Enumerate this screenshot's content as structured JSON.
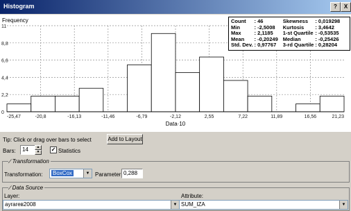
{
  "window": {
    "title": "Histogram",
    "help_label": "?",
    "close_label": "X"
  },
  "chart_data": {
    "type": "bar",
    "ylabel": "Frequency",
    "xlabel": "Data·10",
    "ylim": [
      0,
      11
    ],
    "xlim": [
      -25.47,
      21.23
    ],
    "y_ticks": [
      "0",
      "2,2",
      "4,4",
      "6,6",
      "8,8",
      "11"
    ],
    "x_ticks": [
      "-25,47",
      "-20,8",
      "-16,13",
      "-11,46",
      "-6,79",
      "-2,12",
      "2,55",
      "7,22",
      "11,89",
      "16,56",
      "21,23"
    ],
    "bin_edges": [
      -25.47,
      -22.13,
      -18.8,
      -15.46,
      -12.13,
      -8.79,
      -5.46,
      -2.12,
      1.21,
      4.55,
      7.88,
      11.22,
      14.55,
      17.89,
      21.23
    ],
    "values": [
      1,
      2,
      2,
      3,
      0,
      6,
      10,
      5,
      7,
      4,
      2,
      0,
      1,
      2
    ],
    "bar_fill": "#ffffff",
    "grid": true
  },
  "stats": {
    "rows": [
      {
        "l1": "Count",
        "v1": ": 46",
        "l2": "Skewness",
        "v2": ": 0,019298"
      },
      {
        "l1": "Min",
        "v1": ": -2,5008",
        "l2": "Kurtosis",
        "v2": ": 3,4642"
      },
      {
        "l1": "Max",
        "v1": ": 2,1185",
        "l2": "1-st Quartile",
        "v2": ": -0,53535"
      },
      {
        "l1": "Mean",
        "v1": ": -0,20249",
        "l2": "Median",
        "v2": ": -0,25426"
      },
      {
        "l1": "Std. Dev.",
        "v1": ": 0,97767",
        "l2": "3-rd Quartile",
        "v2": ": 0,28204"
      }
    ]
  },
  "controls": {
    "tip": "Tip:  Click or drag over bars to select",
    "add_layout": "Add to Layout",
    "bars_label": "Bars:",
    "bars_value": "14",
    "statistics_label": "Statistics",
    "statistics_checked": true
  },
  "transformation_group": {
    "title": "Transformation",
    "label": "Transformation:",
    "value": "BoxCox",
    "parameter_label": "Parameter:",
    "parameter_value": "0,288"
  },
  "data_source": {
    "title": "Data Source",
    "layer_label": "Layer:",
    "layer_value": "ayrareв2008",
    "attribute_label": "Attribute:",
    "attribute_value": "SUM_IZA"
  }
}
